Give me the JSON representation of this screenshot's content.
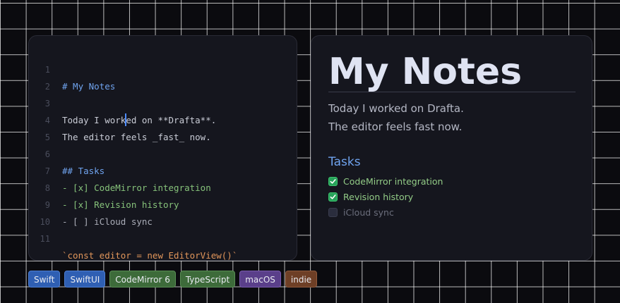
{
  "editor": {
    "lines": [
      {
        "num": "1",
        "text": "# My Notes"
      },
      {
        "num": "2",
        "text": ""
      },
      {
        "num": "3",
        "text_before_cursor": "Today I work",
        "text_after_cursor": "ed on **Drafta**."
      },
      {
        "num": "4",
        "text": "The editor feels _fast_ now."
      },
      {
        "num": "5",
        "text": ""
      },
      {
        "num": "6",
        "text": "## Tasks"
      },
      {
        "num": "7",
        "text": "- [x] CodeMirror integration"
      },
      {
        "num": "8",
        "text": "- [x] Revision history"
      },
      {
        "num": "9",
        "text": "- [ ] iCloud sync"
      },
      {
        "num": "10",
        "text": ""
      },
      {
        "num": "11",
        "text": "`const editor = new EditorView()`"
      }
    ]
  },
  "preview": {
    "title": "My Notes",
    "paragraph_1": "Today I worked on Drafta.",
    "paragraph_2": "The editor feels fast now.",
    "subheading": "Tasks",
    "tasks": [
      {
        "label": "CodeMirror integration",
        "checked": true
      },
      {
        "label": "Revision history",
        "checked": true
      },
      {
        "label": "iCloud sync",
        "checked": false
      }
    ]
  },
  "tags": [
    {
      "label": "Swift",
      "bg": "#2f5fb3",
      "border": "#4d7fd4"
    },
    {
      "label": "SwiftUI",
      "bg": "#2f5fb3",
      "border": "#4d7fd4"
    },
    {
      "label": "CodeMirror 6",
      "bg": "#3d6b3a",
      "border": "#5a8f55"
    },
    {
      "label": "TypeScript",
      "bg": "#3d6b3a",
      "border": "#5a8f55"
    },
    {
      "label": "macOS",
      "bg": "#5a3f8a",
      "border": "#7a5cae"
    },
    {
      "label": "indie",
      "bg": "#6e3f26",
      "border": "#905a3c"
    }
  ],
  "colors": {
    "accent_blue": "#6fa3ee",
    "task_done": "#86c27a",
    "inline_code": "#e0955a",
    "cursor": "#4e8cff"
  },
  "icons": {
    "checkbox_checked": "checkmark-icon",
    "checkbox_unchecked": "empty-checkbox-icon"
  }
}
